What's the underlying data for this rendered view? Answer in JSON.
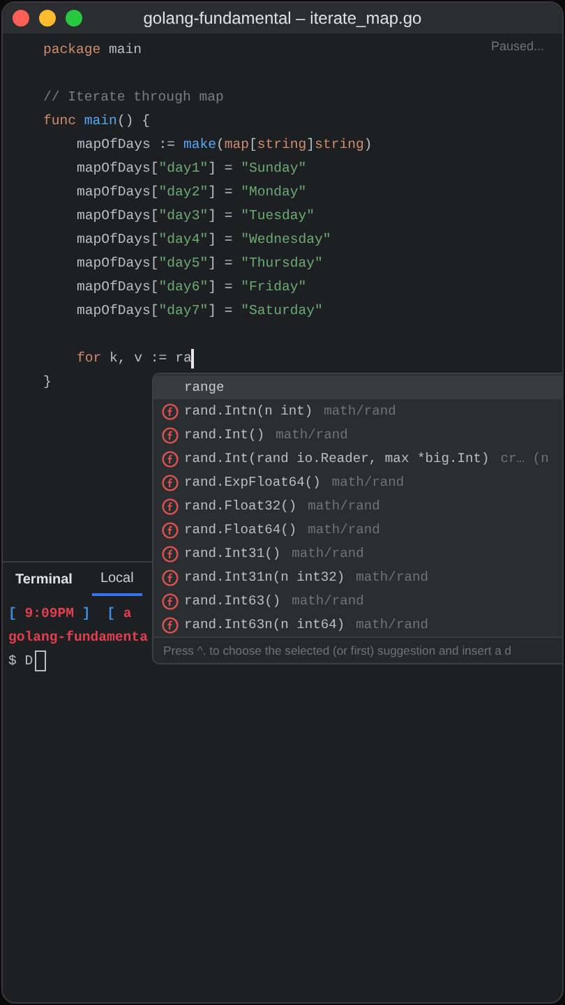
{
  "window": {
    "title": "golang-fundamental – iterate_map.go",
    "status": "Paused..."
  },
  "editor": {
    "lines": [
      {
        "kind": "code",
        "tokens": [
          {
            "kind": "keyword",
            "text": "package "
          },
          {
            "kind": "plain",
            "text": "main"
          }
        ]
      },
      {
        "kind": "blank"
      },
      {
        "kind": "code",
        "tokens": [
          {
            "kind": "comment",
            "text": "// Iterate through map"
          }
        ]
      },
      {
        "kind": "code",
        "tokens": [
          {
            "kind": "keyword",
            "text": "func "
          },
          {
            "kind": "function",
            "text": "main"
          },
          {
            "kind": "plain",
            "text": "() {"
          }
        ],
        "children": [
          {
            "kind": "code",
            "tokens": [
              {
                "kind": "plain",
                "text": "mapOfDays := "
              },
              {
                "kind": "function",
                "text": "make"
              },
              {
                "kind": "plain",
                "text": "("
              },
              {
                "kind": "keyword",
                "text": "map"
              },
              {
                "kind": "plain",
                "text": "["
              },
              {
                "kind": "keyword",
                "text": "string"
              },
              {
                "kind": "plain",
                "text": "]"
              },
              {
                "kind": "keyword",
                "text": "string"
              },
              {
                "kind": "plain",
                "text": ")"
              }
            ]
          },
          {
            "kind": "code",
            "tokens": [
              {
                "kind": "plain",
                "text": "mapOfDays["
              },
              {
                "kind": "string",
                "text": "\"day1\""
              },
              {
                "kind": "plain",
                "text": "] = "
              },
              {
                "kind": "string",
                "text": "\"Sunday\""
              }
            ]
          },
          {
            "kind": "code",
            "tokens": [
              {
                "kind": "plain",
                "text": "mapOfDays["
              },
              {
                "kind": "string",
                "text": "\"day2\""
              },
              {
                "kind": "plain",
                "text": "] = "
              },
              {
                "kind": "string",
                "text": "\"Monday\""
              }
            ]
          },
          {
            "kind": "code",
            "tokens": [
              {
                "kind": "plain",
                "text": "mapOfDays["
              },
              {
                "kind": "string",
                "text": "\"day3\""
              },
              {
                "kind": "plain",
                "text": "] = "
              },
              {
                "kind": "string",
                "text": "\"Tuesday\""
              }
            ]
          },
          {
            "kind": "code",
            "tokens": [
              {
                "kind": "plain",
                "text": "mapOfDays["
              },
              {
                "kind": "string",
                "text": "\"day4\""
              },
              {
                "kind": "plain",
                "text": "] = "
              },
              {
                "kind": "string",
                "text": "\"Wednesday\""
              }
            ]
          },
          {
            "kind": "code",
            "tokens": [
              {
                "kind": "plain",
                "text": "mapOfDays["
              },
              {
                "kind": "string",
                "text": "\"day5\""
              },
              {
                "kind": "plain",
                "text": "] = "
              },
              {
                "kind": "string",
                "text": "\"Thursday\""
              }
            ]
          },
          {
            "kind": "code",
            "tokens": [
              {
                "kind": "plain",
                "text": "mapOfDays["
              },
              {
                "kind": "string",
                "text": "\"day6\""
              },
              {
                "kind": "plain",
                "text": "] = "
              },
              {
                "kind": "string",
                "text": "\"Friday\""
              }
            ]
          },
          {
            "kind": "code",
            "tokens": [
              {
                "kind": "plain",
                "text": "mapOfDays["
              },
              {
                "kind": "string",
                "text": "\"day7\""
              },
              {
                "kind": "plain",
                "text": "] = "
              },
              {
                "kind": "string",
                "text": "\"Saturday\""
              }
            ]
          },
          {
            "kind": "blank"
          },
          {
            "kind": "code",
            "caret": true,
            "tokens": [
              {
                "kind": "keyword",
                "text": "for "
              },
              {
                "kind": "plain",
                "text": "k, v := ra"
              }
            ]
          }
        ]
      },
      {
        "kind": "code",
        "tokens": [
          {
            "kind": "plain",
            "text": "}"
          }
        ]
      }
    ]
  },
  "completion": {
    "items": [
      {
        "kind": "keyword",
        "label": "range",
        "selected": true
      },
      {
        "kind": "function",
        "label": "rand.Intn(n int)",
        "detail": "math/rand",
        "selected": false
      },
      {
        "kind": "function",
        "label": "rand.Int()",
        "detail": "math/rand",
        "selected": false
      },
      {
        "kind": "function",
        "label": "rand.Int(rand io.Reader, max *big.Int)",
        "detail": "cr… (n",
        "selected": false
      },
      {
        "kind": "function",
        "label": "rand.ExpFloat64()",
        "detail": "math/rand",
        "selected": false
      },
      {
        "kind": "function",
        "label": "rand.Float32()",
        "detail": "math/rand",
        "selected": false
      },
      {
        "kind": "function",
        "label": "rand.Float64()",
        "detail": "math/rand",
        "selected": false
      },
      {
        "kind": "function",
        "label": "rand.Int31()",
        "detail": "math/rand",
        "selected": false
      },
      {
        "kind": "function",
        "label": "rand.Int31n(n int32)",
        "detail": "math/rand",
        "selected": false
      },
      {
        "kind": "function",
        "label": "rand.Int63()",
        "detail": "math/rand",
        "selected": false
      },
      {
        "kind": "function",
        "label": "rand.Int63n(n int64)",
        "detail": "math/rand",
        "selected": false
      }
    ],
    "hint": "Press ^. to choose the selected (or first) suggestion and insert a d"
  },
  "terminal": {
    "title": "Terminal",
    "tabs": [
      {
        "label": "Local",
        "selected": true
      }
    ],
    "lines": [
      {
        "tokens": [
          {
            "kind": "bracket",
            "text": "[ "
          },
          {
            "kind": "time",
            "text": "9:09PM"
          },
          {
            "kind": "bracket",
            "text": " ]  [ "
          },
          {
            "kind": "time",
            "text": "a"
          }
        ]
      },
      {
        "tokens": [
          {
            "kind": "time",
            "text": "golang-fundamenta"
          }
        ]
      },
      {
        "caret": true,
        "tokens": [
          {
            "kind": "plain",
            "text": "$ D"
          }
        ]
      }
    ]
  }
}
